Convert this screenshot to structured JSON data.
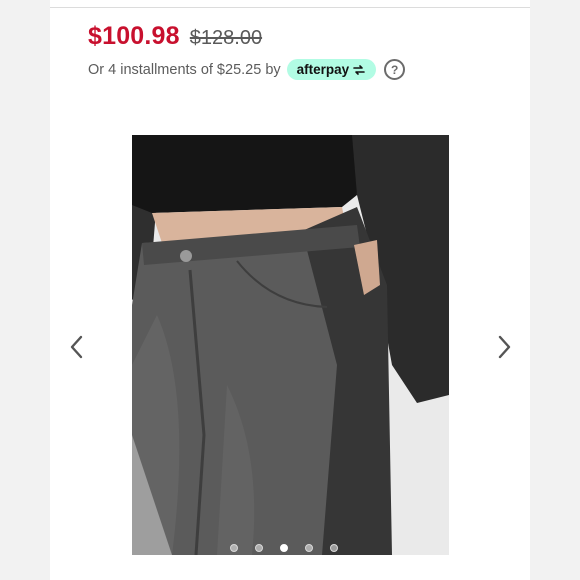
{
  "pricing": {
    "sale_price": "$100.98",
    "original_price": "$128.00",
    "installments_text": "Or 4 installments of $25.25 by",
    "afterpay_label": "afterpay",
    "help_glyph": "?"
  },
  "gallery": {
    "image_alt": "Model wearing two-tone washed black high-rise 501 jeans",
    "prev_icon": "chevron-left-icon",
    "next_icon": "chevron-right-icon",
    "slide_count": 5,
    "active_slide": 3
  },
  "colors": {
    "sale_price": "#c8102e",
    "afterpay_badge": "#b2fce4"
  }
}
